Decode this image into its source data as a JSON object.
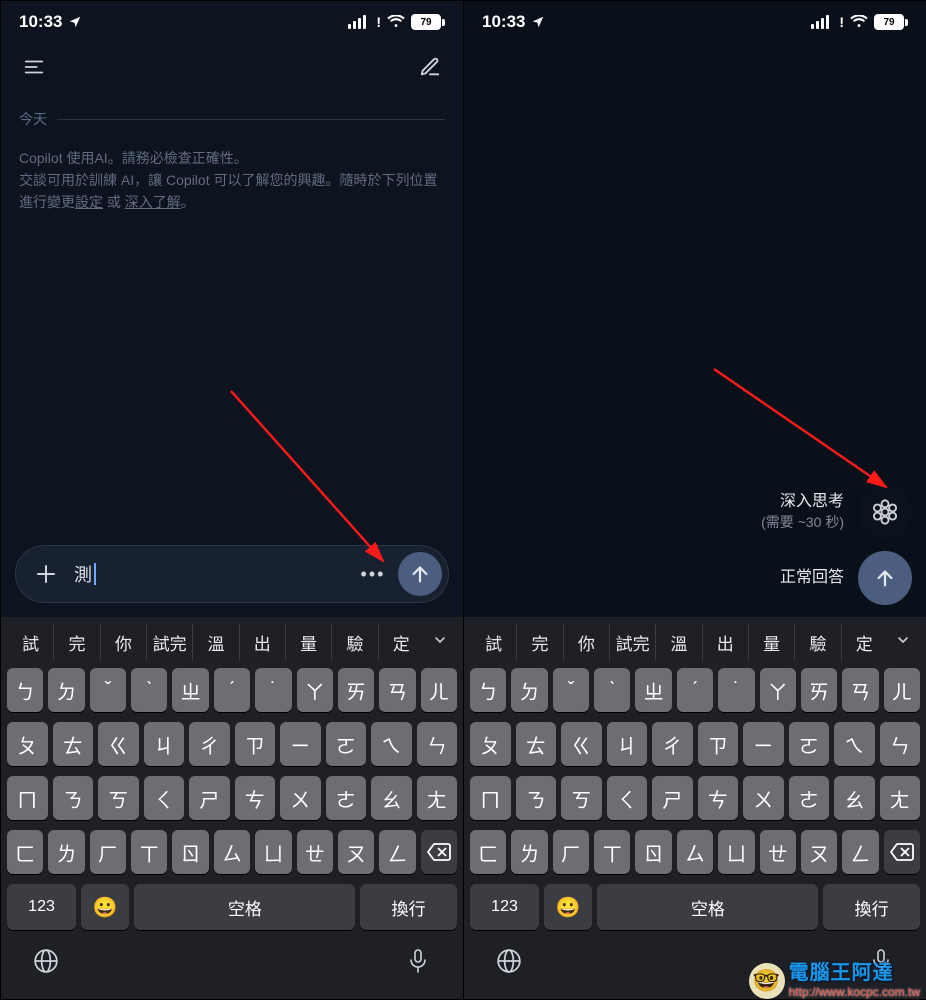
{
  "status": {
    "time": "10:33",
    "battery": "79"
  },
  "left": {
    "section_label": "今天",
    "disclaimer_line1": "Copilot 使用AI。請務必檢查正確性。",
    "disclaimer_line2a": "交談可用於訓練 AI，讓 Copilot 可以了解您的興趣。隨時於下列位置進行變更",
    "disclaimer_settings": "設定",
    "disclaimer_or": " 或 ",
    "disclaimer_learn": "深入了解",
    "disclaimer_dot": "。",
    "input_text": "測",
    "more": "•••"
  },
  "right": {
    "opt1_title": "深入思考",
    "opt1_sub": "(需要 ~30 秒)",
    "opt2_title": "正常回答"
  },
  "keyboard": {
    "suggestions": [
      "試",
      "完",
      "你",
      "試完",
      "溫",
      "出",
      "量",
      "驗",
      "定"
    ],
    "row1": [
      "ㄅ",
      "ㄉ",
      "ˇ",
      "ˋ",
      "ㄓ",
      "ˊ",
      "˙",
      "ㄚ",
      "ㄞ",
      "ㄢ",
      "ㄦ"
    ],
    "row2": [
      "ㄆ",
      "ㄊ",
      "ㄍ",
      "ㄐ",
      "ㄔ",
      "ㄗ",
      "ㄧ",
      "ㄛ",
      "ㄟ",
      "ㄣ"
    ],
    "row3": [
      "ㄇ",
      "ㄋ",
      "ㄎ",
      "ㄑ",
      "ㄕ",
      "ㄘ",
      "ㄨ",
      "ㄜ",
      "ㄠ",
      "ㄤ"
    ],
    "row4": [
      "ㄈ",
      "ㄌ",
      "ㄏ",
      "ㄒ",
      "ㄖ",
      "ㄙ",
      "ㄩ",
      "ㄝ",
      "ㄡ",
      "ㄥ"
    ],
    "num": "123",
    "space": "空格",
    "return": "換行"
  },
  "watermark": {
    "brand": "電腦王阿達",
    "url": "http://www.kocpc.com.tw"
  }
}
